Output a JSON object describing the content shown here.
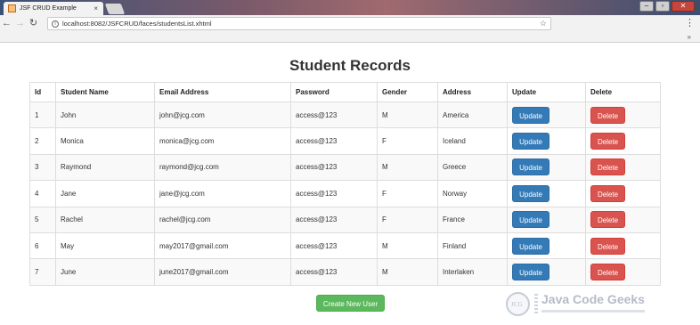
{
  "browser": {
    "tab_title": "JSF CRUD Example",
    "tab_close": "×",
    "url": "localhost:8082/JSFCRUD/faces/studentsList.xhtml",
    "win_minimize": "–",
    "win_maximize": "▫",
    "win_close": "✕",
    "bookmarks_more": "»"
  },
  "page": {
    "title": "Student Records",
    "create_button": "Create New User"
  },
  "table": {
    "headers": {
      "id": "Id",
      "name": "Student Name",
      "email": "Email Address",
      "password": "Password",
      "gender": "Gender",
      "address": "Address",
      "update": "Update",
      "delete": "Delete"
    },
    "rows": [
      {
        "id": "1",
        "name": "John",
        "email": "john@jcg.com",
        "password": "access@123",
        "gender": "M",
        "address": "America"
      },
      {
        "id": "2",
        "name": "Monica",
        "email": "monica@jcg.com",
        "password": "access@123",
        "gender": "F",
        "address": "Iceland"
      },
      {
        "id": "3",
        "name": "Raymond",
        "email": "raymond@jcg.com",
        "password": "access@123",
        "gender": "M",
        "address": "Greece"
      },
      {
        "id": "4",
        "name": "Jane",
        "email": "jane@jcg.com",
        "password": "access@123",
        "gender": "F",
        "address": "Norway"
      },
      {
        "id": "5",
        "name": "Rachel",
        "email": "rachel@jcg.com",
        "password": "access@123",
        "gender": "F",
        "address": "France"
      },
      {
        "id": "6",
        "name": "May",
        "email": "may2017@gmail.com",
        "password": "access@123",
        "gender": "M",
        "address": "Finland"
      },
      {
        "id": "7",
        "name": "June",
        "email": "june2017@gmail.com",
        "password": "access@123",
        "gender": "M",
        "address": "Interlaken"
      }
    ],
    "update_label": "Update",
    "delete_label": "Delete"
  },
  "watermark": {
    "text": "Java Code Geeks",
    "badge": "JCG"
  },
  "colors": {
    "update": "#337ab7",
    "delete": "#d9534f",
    "create": "#5cb85c"
  }
}
